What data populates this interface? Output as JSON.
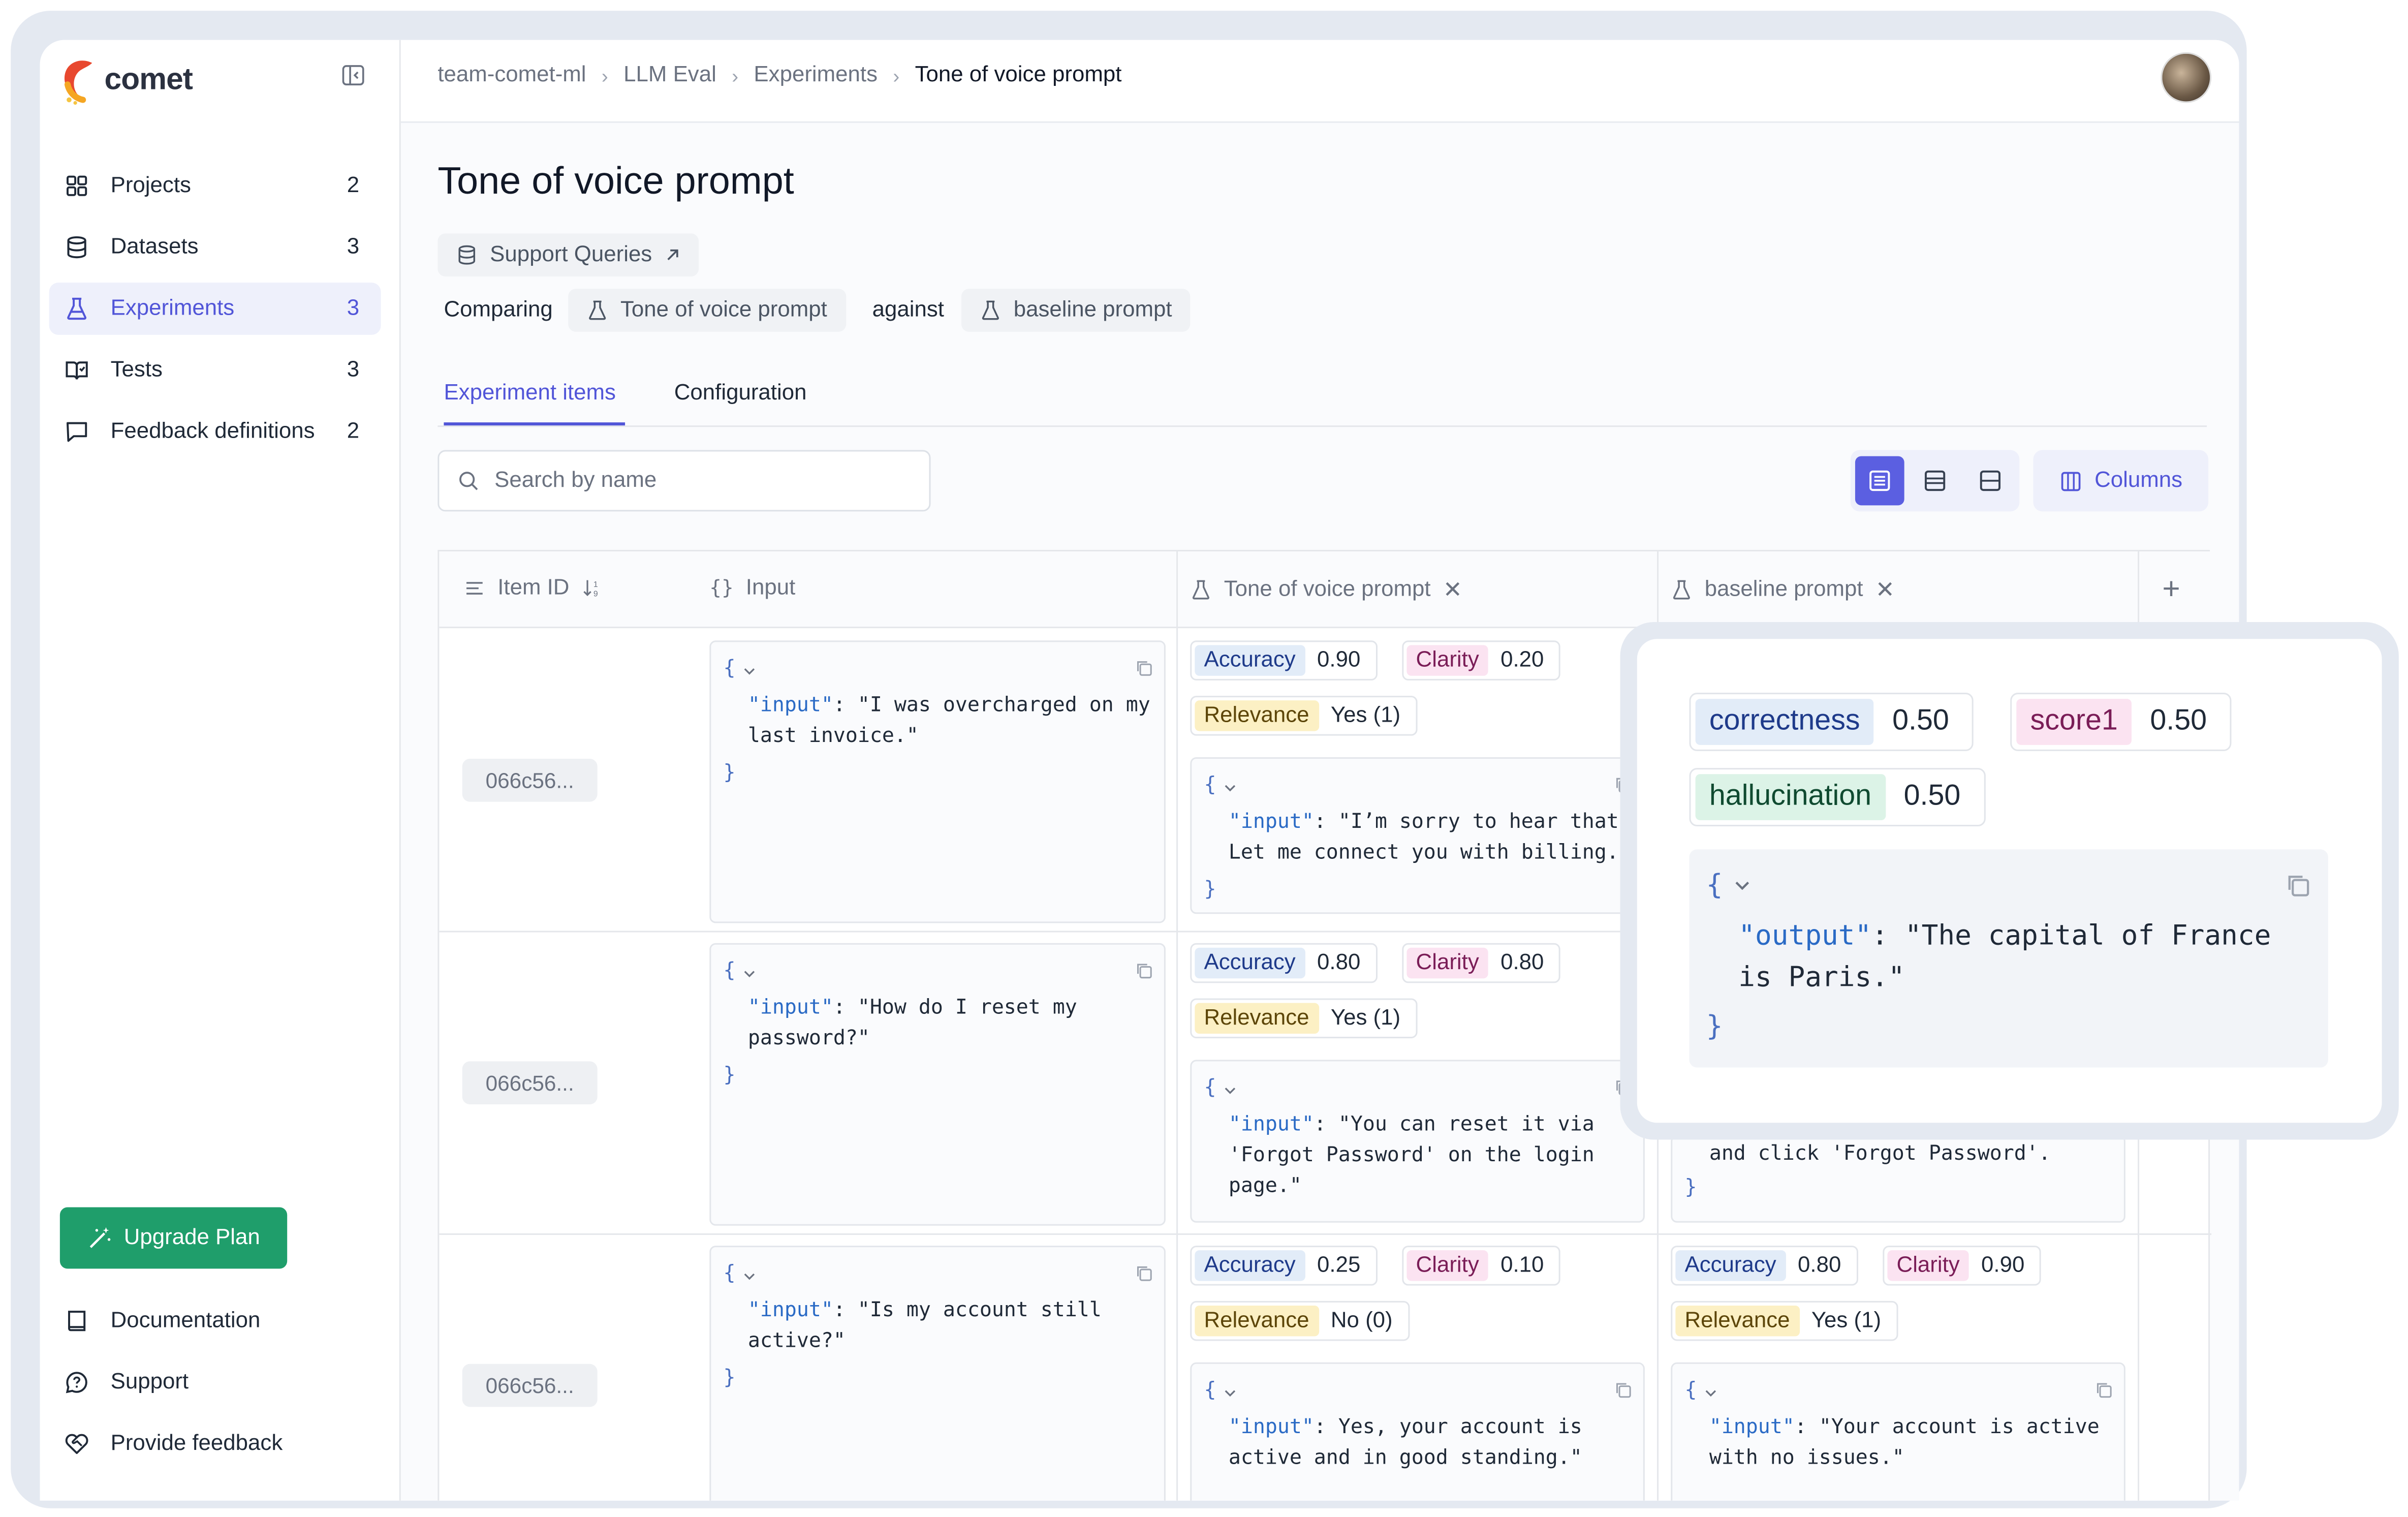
{
  "app": {
    "brand": "comet"
  },
  "colors": {
    "accent": "#5155d8",
    "upgrade": "#1f9e6b",
    "accuracy_tag": "#e2ecf8",
    "clarity_tag": "#fbe3f1",
    "relevance_tag": "#fcf0c4",
    "hallucination_tag": "#dcf3e7"
  },
  "sidebar": {
    "items": [
      {
        "label": "Projects",
        "count": "2",
        "icon": "grid-icon"
      },
      {
        "label": "Datasets",
        "count": "3",
        "icon": "database-icon"
      },
      {
        "label": "Experiments",
        "count": "3",
        "icon": "flask-icon"
      },
      {
        "label": "Tests",
        "count": "3",
        "icon": "book-check-icon"
      },
      {
        "label": "Feedback definitions",
        "count": "2",
        "icon": "message-square-icon"
      }
    ],
    "upgrade_label": "Upgrade Plan",
    "bottom": [
      {
        "label": "Documentation",
        "icon": "book-icon"
      },
      {
        "label": "Support",
        "icon": "help-circle-icon"
      },
      {
        "label": "Provide feedback",
        "icon": "heart-handshake-icon"
      }
    ]
  },
  "breadcrumb": [
    "team-comet-ml",
    "LLM Eval",
    "Experiments",
    "Tone of voice prompt"
  ],
  "page": {
    "title": "Tone of voice prompt",
    "dataset_link": "Support Queries",
    "comparing_label": "Comparing",
    "experiment_a": "Tone of voice prompt",
    "against_label": "against",
    "experiment_b": "baseline prompt",
    "tabs": [
      "Experiment items",
      "Configuration"
    ],
    "search_placeholder": "Search by name",
    "columns_label": "Columns"
  },
  "table": {
    "headers": {
      "item_id": "Item ID",
      "input": "Input",
      "exp_a": "Tone of voice prompt",
      "exp_b": "baseline prompt"
    },
    "rows": [
      {
        "id": "066c56...",
        "input": "\"I was overcharged on my\nlast invoice.\"",
        "a_scores": {
          "accuracy": "0.90",
          "clarity": "0.20",
          "relevance": "Yes (1)"
        },
        "a_output": "\"I’m sorry to hear that.\nLet me connect you with billing.\""
      },
      {
        "id": "066c56...",
        "input": "\"How do I reset my\npassword?\"",
        "a_scores": {
          "accuracy": "0.80",
          "clarity": "0.80",
          "relevance": "Yes (1)"
        },
        "a_output": "\"You can reset it via\n'Forgot Password' on the login\npage.\"",
        "b_output_tail": "and click 'Forgot Password'."
      },
      {
        "id": "066c56...",
        "input": "\"Is my account still\nactive?\"",
        "a_scores": {
          "accuracy": "0.25",
          "clarity": "0.10",
          "relevance": "No (0)"
        },
        "a_output": "Yes, your account is\nactive and in good standing.\"",
        "b_scores": {
          "accuracy": "0.80",
          "clarity": "0.90",
          "relevance": "Yes (1)"
        },
        "b_output": "\"Your account is active\nwith no issues.\""
      }
    ],
    "labels": {
      "accuracy": "Accuracy",
      "clarity": "Clarity",
      "relevance": "Relevance",
      "input_key": "\"input\"",
      "output_key": "\"output\""
    }
  },
  "popup": {
    "scores": [
      {
        "name": "correctness",
        "value": "0.50"
      },
      {
        "name": "score1",
        "value": "0.50"
      },
      {
        "name": "hallucination",
        "value": "0.50"
      }
    ],
    "output": "\"The capital of France\nis Paris.\""
  }
}
